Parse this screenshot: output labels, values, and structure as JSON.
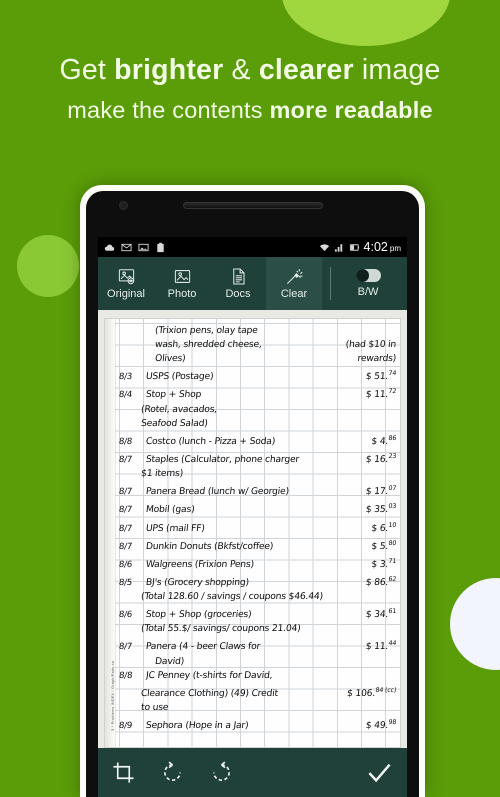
{
  "background": {
    "color": "#5a9d08",
    "circle_top_color": "#a0d73f",
    "circle_left_color": "#8bc934",
    "circle_right_color": "#f3f5fd"
  },
  "headline": {
    "line1_prefix": "Get ",
    "line1_bold1": "brighter",
    "line1_mid": " & ",
    "line1_bold2": "clearer",
    "line1_suffix": " image",
    "line2_prefix": "make the contents ",
    "line2_bold": "more readable"
  },
  "status_bar": {
    "icons": [
      "cloud-icon",
      "gmail-icon",
      "photo-icon",
      "clipboard-icon",
      "wifi-icon",
      "signal-icon",
      "battery-icon"
    ],
    "time": "4:02",
    "ampm": "pm"
  },
  "toolbar": {
    "accent": "#20403a",
    "tabs": [
      {
        "label": "Original",
        "icon": "image-original-icon",
        "selected": false
      },
      {
        "label": "Photo",
        "icon": "image-photo-icon",
        "selected": false
      },
      {
        "label": "Docs",
        "icon": "document-icon",
        "selected": false
      },
      {
        "label": "Clear",
        "icon": "magic-wand-icon",
        "selected": true
      }
    ],
    "bw_label": "B/W",
    "bw_enabled": false
  },
  "document": {
    "side_print": "5 * Problems  INDEX / Graph/Pads.ca",
    "lines": [
      {
        "style": "indent",
        "date": "",
        "desc": "(Trixion pens, olay tape",
        "amt": ""
      },
      {
        "style": "indent",
        "date": "",
        "desc": "wash, shredded cheese,",
        "amt": "(had $10 in"
      },
      {
        "style": "indent",
        "date": "",
        "desc": "Olives)",
        "amt": "rewards)"
      },
      {
        "style": "normal",
        "date": "8/3",
        "desc": "USPS (Postage)",
        "amt": "$ 51.",
        "cents": "74"
      },
      {
        "style": "normal",
        "date": "8/4",
        "desc": "Stop + Shop",
        "amt": "$ 11.",
        "cents": "72"
      },
      {
        "style": "indent2",
        "date": "",
        "desc": "(Rotel, avacados,",
        "amt": ""
      },
      {
        "style": "indent2",
        "date": "",
        "desc": "Seafood Salad)",
        "amt": ""
      },
      {
        "style": "normal",
        "date": "8/8",
        "desc": "Costco (lunch - Pizza + Soda)",
        "amt": "$ 4.",
        "cents": "86"
      },
      {
        "style": "normal",
        "date": "8/7",
        "desc": "Staples (Calculator, phone charger",
        "amt": "$ 16.",
        "cents": "23"
      },
      {
        "style": "indent2",
        "date": "",
        "desc": "$1 items)",
        "amt": ""
      },
      {
        "style": "normal",
        "date": "8/7",
        "desc": "Panera Bread (lunch w/ Georgie)",
        "amt": "$ 17.",
        "cents": "07"
      },
      {
        "style": "normal",
        "date": "8/7",
        "desc": "Mobil (gas)",
        "amt": "$ 35.",
        "cents": "03"
      },
      {
        "style": "normal",
        "date": "8/7",
        "desc": "UPS (mail FF)",
        "amt": "$ 6.",
        "cents": "10"
      },
      {
        "style": "normal",
        "date": "8/7",
        "desc": "Dunkin Donuts (Bkfst/coffee)",
        "amt": "$ 5.",
        "cents": "80"
      },
      {
        "style": "normal",
        "date": "8/6",
        "desc": "Walgreens (Frixion Pens)",
        "amt": "$ 3.",
        "cents": "71"
      },
      {
        "style": "normal",
        "date": "8/5",
        "desc": "BJ's (Grocery shopping)",
        "amt": "$ 86.",
        "cents": "62"
      },
      {
        "style": "indent2",
        "date": "",
        "desc": "(Total 128.60 / savings / coupons $46.44)",
        "amt": ""
      },
      {
        "style": "normal",
        "date": "8/6",
        "desc": "Stop + Shop (groceries)",
        "amt": "$ 34.",
        "cents": "61"
      },
      {
        "style": "indent2",
        "date": "",
        "desc": "(Total 55.$/ savings/ coupons 21.04)",
        "amt": ""
      },
      {
        "style": "normal",
        "date": "8/7",
        "desc": "Panera (4 - beer Claws for",
        "amt": "$ 11.",
        "cents": "44"
      },
      {
        "style": "indent",
        "date": "",
        "desc": "David)",
        "amt": ""
      },
      {
        "style": "normal",
        "date": "8/8",
        "desc": "JC Penney (t-shirts for David,",
        "amt": ""
      },
      {
        "style": "indent2",
        "date": "",
        "desc": "Clearance Clothing) (49) Credit",
        "amt": "$ 106.",
        "cents": "84 (cc)"
      },
      {
        "style": "indent2",
        "date": "",
        "desc": "to use",
        "amt": ""
      },
      {
        "style": "normal",
        "date": "8/9",
        "desc": "Sephora (Hope in a Jar)",
        "amt": "$ 49.",
        "cents": "98"
      }
    ]
  },
  "bottom_bar": {
    "buttons": [
      {
        "name": "crop-icon",
        "label": "Crop"
      },
      {
        "name": "rotate-left-icon",
        "label": "Rotate left"
      },
      {
        "name": "rotate-right-icon",
        "label": "Rotate right"
      }
    ],
    "done": {
      "name": "checkmark-icon",
      "label": "Done"
    }
  }
}
